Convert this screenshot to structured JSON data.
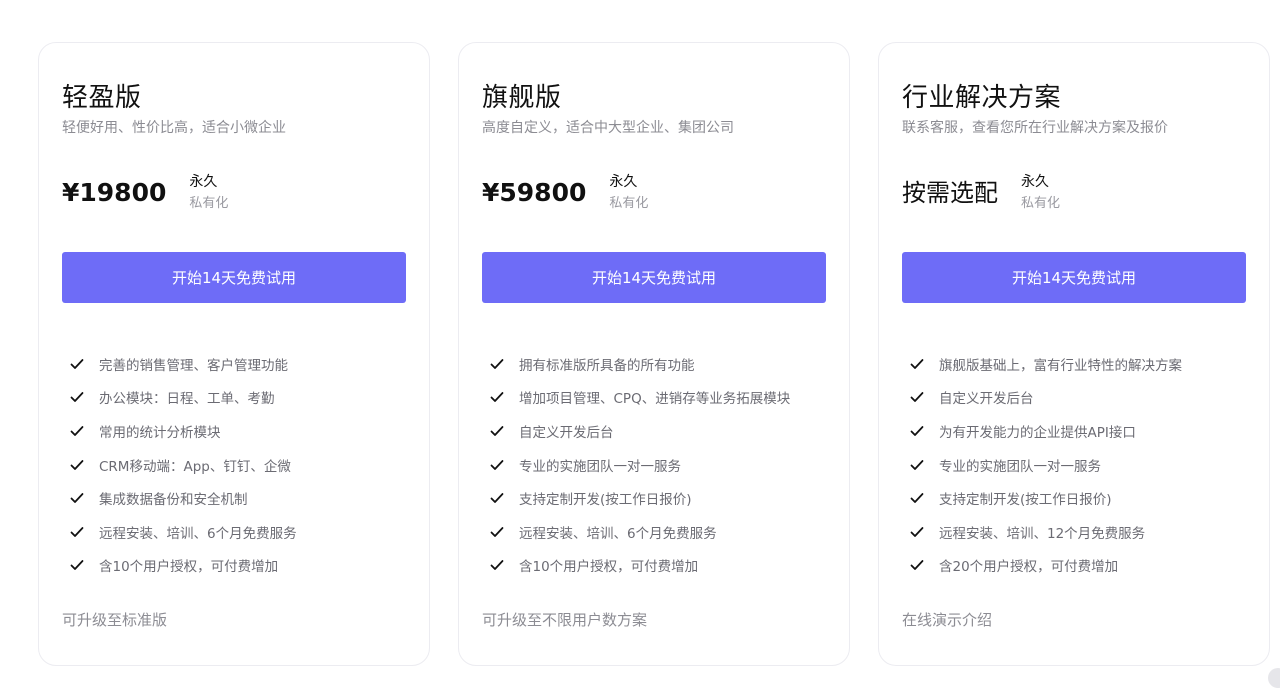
{
  "plans": [
    {
      "name": "轻盈版",
      "desc": "轻便好用、性价比高，适合小微企业",
      "price": "¥19800",
      "term": "永久",
      "license": "私有化",
      "cta": "开始14天免费试用",
      "features": [
        "完善的销售管理、客户管理功能",
        "办公模块：日程、工单、考勤",
        "常用的统计分析模块",
        "CRM移动端：App、钉钉、企微",
        "集成数据备份和安全机制",
        "远程安装、培训、6个月免费服务",
        "含10个用户授权，可付费增加"
      ],
      "footer": "可升级至标准版"
    },
    {
      "name": "旗舰版",
      "desc": "高度自定义，适合中大型企业、集团公司",
      "price": "¥59800",
      "term": "永久",
      "license": "私有化",
      "cta": "开始14天免费试用",
      "features": [
        "拥有标准版所具备的所有功能",
        "增加项目管理、CPQ、进销存等业务拓展模块",
        "自定义开发后台",
        "专业的实施团队一对一服务",
        "支持定制开发(按工作日报价)",
        "远程安装、培训、6个月免费服务",
        "含10个用户授权，可付费增加"
      ],
      "footer": "可升级至不限用户数方案"
    },
    {
      "name": "行业解决方案",
      "desc": "联系客服，查看您所在行业解决方案及报价",
      "price": "按需选配",
      "term": "永久",
      "license": "私有化",
      "cta": "开始14天免费试用",
      "features": [
        "旗舰版基础上，富有行业特性的解决方案",
        "自定义开发后台",
        "为有开发能力的企业提供API接口",
        "专业的实施团队一对一服务",
        "支持定制开发(按工作日报价)",
        "远程安装、培训、12个月免费服务",
        "含20个用户授权，可付费增加"
      ],
      "footer": "在线演示介绍"
    }
  ],
  "icons": {
    "feature_check": "check-icon"
  },
  "colors": {
    "accent": "#6e6cf7",
    "muted_text": "#8c8c93",
    "card_border": "#ececf1"
  }
}
